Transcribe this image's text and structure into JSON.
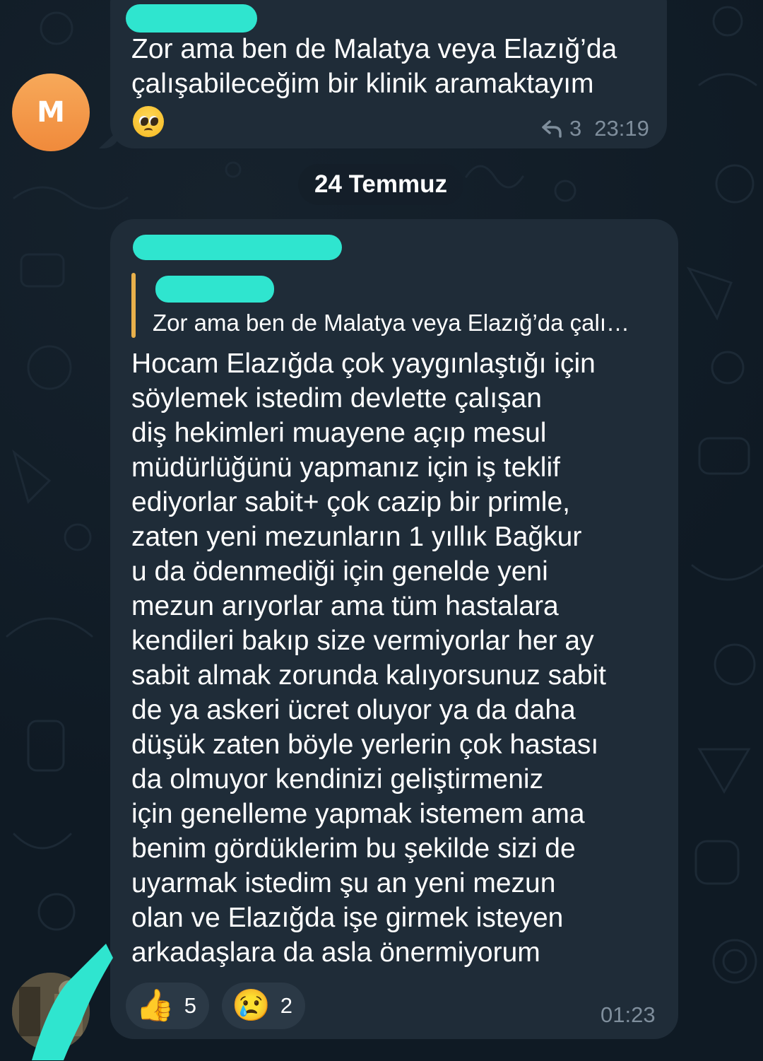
{
  "message_1": {
    "avatar_initial": "M",
    "text": "Zor ama ben de Malatya veya Elazığ’da\nçalışabileceğim bir klinik aramaktayım",
    "reply_count": "3",
    "time": "23:19"
  },
  "date_separator": "24 Temmuz",
  "message_2": {
    "reply_preview_text": "Zor ama ben de Malatya veya Elazığ’da çalı…",
    "text": "Hocam Elazığda çok yaygınlaştığı için\nsöylemek istedim devlette çalışan\ndiş hekimleri muayene açıp mesul\nmüdürlüğünü yapmanız için iş teklif\nediyorlar sabit+ çok cazip bir primle,\nzaten yeni mezunların 1 yıllık Bağkur\nu da ödenmediği için genelde yeni\nmezun arıyorlar ama tüm hastalara\nkendileri bakıp size vermiyorlar her ay\nsabit almak zorunda kalıyorsunuz sabit\nde ya askeri ücret oluyor ya da daha\ndüşük zaten böyle yerlerin çok hastası\nda olmuyor kendinizi geliştirmeniz\niçin genelleme yapmak istemem ama\nbenim gördüklerim bu şekilde sizi de\nuyarmak istedim şu an yeni mezun\nolan ve Elazığda işe girmek isteyen\narkadaşlara da asla önermiyorum",
    "time": "01:23",
    "reactions": [
      {
        "emoji": "👍",
        "count": "5"
      },
      {
        "emoji": "😢",
        "count": "2"
      }
    ]
  },
  "colors": {
    "background": "#0f1a24",
    "bubble": "#1f2c38",
    "redaction": "#2fe5cf",
    "reply_bar": "#e8b04b",
    "meta": "#7f8e9c",
    "avatar": "#f39a45"
  },
  "icons": {
    "reply": "reply-arrow-icon"
  }
}
